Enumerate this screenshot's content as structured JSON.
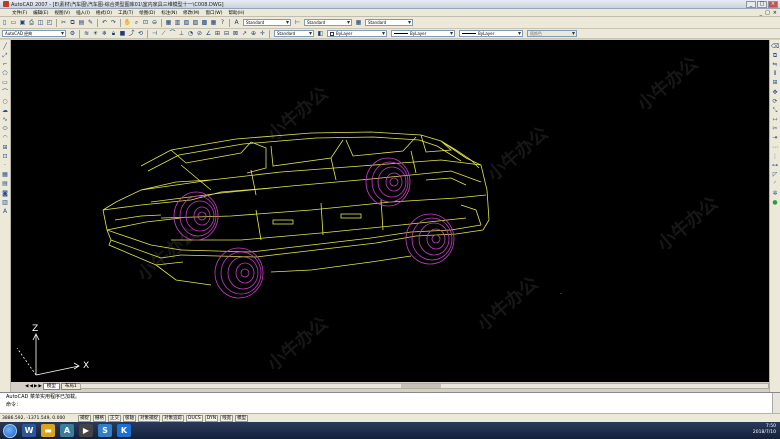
{
  "window": {
    "title": "AutoCAD 2007 - [E\\素材\\汽车图\\汽车图-综合类型图库01\\室内家具三维模型十一\\C008.DWG]",
    "controls": [
      "_",
      "□",
      "×"
    ]
  },
  "menu": {
    "items": [
      "文件(F)",
      "编辑(E)",
      "视图(V)",
      "插入(I)",
      "格式(O)",
      "工具(T)",
      "绘图(D)",
      "标注(N)",
      "修改(M)",
      "窗口(W)",
      "帮助(H)"
    ],
    "right_controls": [
      "_",
      "□",
      "×"
    ]
  },
  "toolbar": {
    "text_style": "Standard",
    "dim_style": "Standard",
    "table_style": "Standard",
    "workspace": "AutoCAD 经典",
    "mleader_style": "Standard",
    "color": "ByLayer",
    "linetype": "ByLayer",
    "lineweight": "ByLayer",
    "plot_style": "随颜色"
  },
  "canvas": {
    "background": "#000000",
    "line_color": "#e6e64a",
    "wheel_color": "#c83cc8",
    "axis_labels": {
      "z": "Z",
      "x": "X"
    },
    "watermark_text": "小牛办公",
    "status_dot": "·"
  },
  "tabs": {
    "items": [
      "模型",
      "布局1"
    ],
    "active": "模型",
    "nav": [
      "◀",
      "◀",
      "▶",
      "▶"
    ]
  },
  "command": {
    "lines": [
      "AutoCAD 菜单实用程序已加载。",
      "命令："
    ]
  },
  "status": {
    "coords": "3886.592, -1371.549, 0.000",
    "toggles": [
      "捕捉",
      "栅格",
      "正交",
      "极轴",
      "对象捕捉",
      "对象追踪",
      "DUCS",
      "DYN",
      "线宽",
      "模型"
    ]
  },
  "taskbar": {
    "apps": [
      {
        "icon": "word-icon",
        "glyph": "W",
        "color": "#2b579a"
      },
      {
        "icon": "folder-icon",
        "glyph": "▬",
        "color": "#d9a520"
      },
      {
        "icon": "autocad-icon",
        "glyph": "A",
        "color": "#3a7d9c"
      },
      {
        "icon": "media-icon",
        "glyph": "▶",
        "color": "#444"
      },
      {
        "icon": "sogou-icon",
        "glyph": "S",
        "color": "#2f80c9"
      },
      {
        "icon": "kugou-icon",
        "glyph": "K",
        "color": "#1b6fd6"
      }
    ],
    "time": "7:50",
    "date": "2018/7/10"
  }
}
